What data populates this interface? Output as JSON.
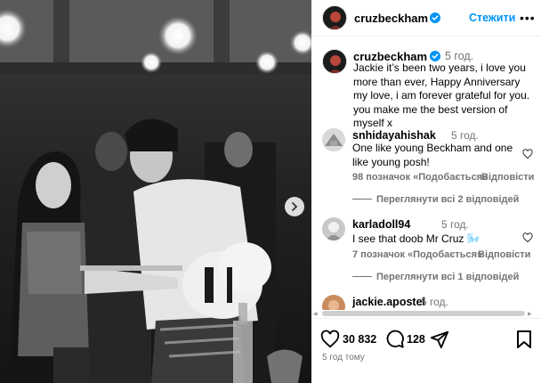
{
  "post": {
    "username": "cruzbeckham",
    "follow_label": "Стежити",
    "more_label": "•••",
    "caption": {
      "username": "cruzbeckham",
      "time": "5 год.",
      "text": "Jackie it’s been two years, i love you more than ever, Happy Anniversary my love, i am forever grateful for you. you make me the best version of myself x"
    },
    "comments": [
      {
        "username": "snhidayahishak",
        "time": "5 год.",
        "text": "One like young Beckham and one like young posh!",
        "likes": "98 позначок «Подобається»",
        "reply": "Відповісти",
        "view_replies": "Переглянути всі 2 відповідей"
      },
      {
        "username": "karladoll94",
        "time": "5 год.",
        "text": "I see that doob Mr Cruz 🌬️",
        "likes": "7 позначок «Подобається»",
        "reply": "Відповісти",
        "view_replies": "Переглянути всі 1 відповідей"
      },
      {
        "username": "jackie.apostel",
        "time": "5 год."
      }
    ],
    "likes_count": "30 832",
    "comments_count": "128",
    "posted_time": "5 год тому"
  },
  "icons": {
    "verified": "verified-badge-icon",
    "heart": "heart-icon",
    "comment": "comment-icon",
    "share": "send-icon",
    "save": "bookmark-icon",
    "next": "chevron-right-icon"
  },
  "colors": {
    "accent": "#0095f6",
    "secondary_text": "#737373",
    "divider": "#efefef"
  }
}
